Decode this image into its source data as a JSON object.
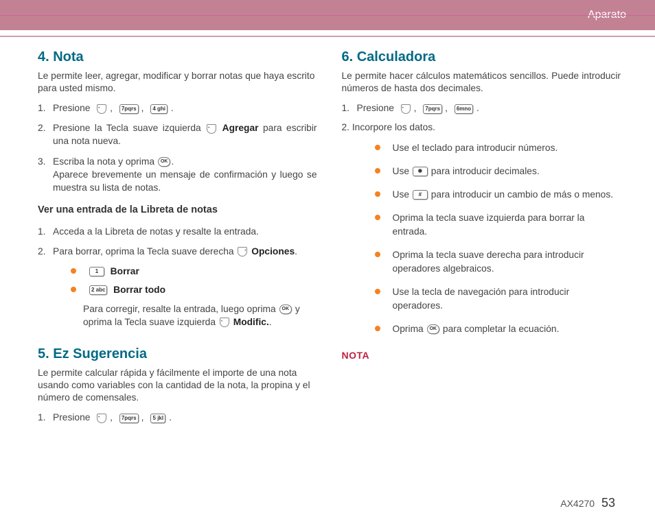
{
  "header": {
    "title": "Aparato"
  },
  "left": {
    "nota": {
      "heading": "4. Nota",
      "intro": "Le permite leer, agregar, modificar y borrar notas que haya escrito para usted mismo.",
      "step1_pre": "Presione",
      "step2_pre": "Presione la Tecla suave izquierda",
      "step2_bold": "Agregar",
      "step2_post": "para escribir una nota nueva.",
      "step3_pre": "Escriba la nota y oprima",
      "step3_post": ".",
      "step3_line2": "Aparece brevemente un mensaje de confirmación y luego se muestra su lista de notas.",
      "subhead": "Ver una entrada de la Libreta de notas",
      "view1": "Acceda a la Libreta de notas y resalte la entrada.",
      "view2_pre": "Para borrar, oprima la Tecla suave derecha",
      "view2_bold": "Opciones",
      "opt1": "Borrar",
      "opt2": "Borrar todo",
      "corr_pre": "Para corregir, resalte la entrada, luego oprima",
      "corr_mid": "y oprima la Tecla suave izquierda",
      "corr_bold": "Modific.",
      "corr_end": "."
    },
    "ez": {
      "heading": "5. Ez Sugerencia",
      "intro": "Le permite calcular rápida y fácilmente el importe de una nota usando como variables con la cantidad de la nota, la propina y el número de comensales.",
      "step1_pre": "Presione"
    }
  },
  "right": {
    "calc": {
      "heading": "6. Calculadora",
      "intro": "Le permite hacer cálculos matemáticos sencillos. Puede introducir números de hasta dos decimales.",
      "step1_pre": "Presione",
      "step2": "2. Incorpore los datos.",
      "b1": "Use el teclado para introducir números.",
      "b2_pre": "Use",
      "b2_post": "para introducir decimales.",
      "b3_pre": "Use",
      "b3_post": "para introducir un cambio de más o menos.",
      "b4": "Oprima la tecla suave izquierda para borrar la entrada.",
      "b5": "Oprima la tecla suave derecha para introducir operadores algebraicos.",
      "b6": "Use la tecla de navegación para introducir operadores.",
      "b7_pre": "Oprima",
      "b7_post": "para completar la ecuación.",
      "nota": "NOTA"
    }
  },
  "keys": {
    "seven": "7pqrs",
    "four": "4 ghi",
    "five": "5 jkl",
    "six": "6mno",
    "one": "1",
    "two": "2 abc",
    "star": "✱",
    "hash": "#",
    "ok": "OK"
  },
  "footer": {
    "model": "AX4270",
    "page": "53"
  }
}
